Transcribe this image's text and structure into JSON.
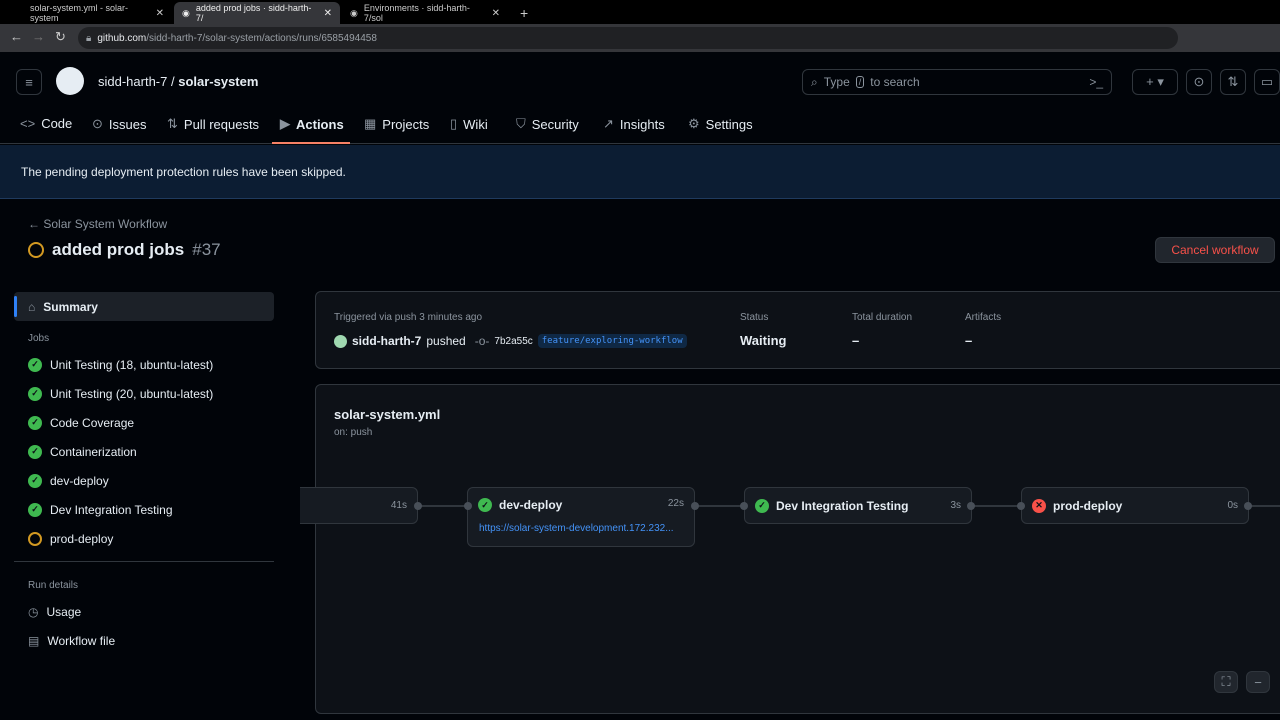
{
  "browser": {
    "tabs": [
      {
        "title": "solar-system.yml - solar-system"
      },
      {
        "title": "added prod jobs · sidd-harth-7/"
      },
      {
        "title": "Environments · sidd-harth-7/sol"
      }
    ],
    "url_domain": "github.com",
    "url_path": "/sidd-harth-7/solar-system/actions/runs/6585494458"
  },
  "header": {
    "owner": "sidd-harth-7",
    "repo": "solar-system",
    "search_pre": "Type",
    "search_key": "/",
    "search_post": "to search"
  },
  "repo_tabs": [
    "Code",
    "Issues",
    "Pull requests",
    "Actions",
    "Projects",
    "Wiki",
    "Security",
    "Insights",
    "Settings"
  ],
  "banner": "The pending deployment protection rules have been skipped.",
  "run": {
    "back": "Solar System Workflow",
    "title": "added prod jobs",
    "number": "#37",
    "cancel": "Cancel workflow"
  },
  "sidebar": {
    "summary": "Summary",
    "jobs_heading": "Jobs",
    "jobs": [
      {
        "name": "Unit Testing (18, ubuntu-latest)",
        "status": "success"
      },
      {
        "name": "Unit Testing (20, ubuntu-latest)",
        "status": "success"
      },
      {
        "name": "Code Coverage",
        "status": "success"
      },
      {
        "name": "Containerization",
        "status": "success"
      },
      {
        "name": "dev-deploy",
        "status": "success"
      },
      {
        "name": "Dev Integration Testing",
        "status": "success"
      },
      {
        "name": "prod-deploy",
        "status": "waiting"
      }
    ],
    "details_heading": "Run details",
    "usage": "Usage",
    "workflow_file": "Workflow file"
  },
  "summary": {
    "triggered": "Triggered via push 3 minutes ago",
    "actor": "sidd-harth-7",
    "action": "pushed",
    "commit": "7b2a55c",
    "branch": "feature/exploring-workflow",
    "status_label": "Status",
    "status": "Waiting",
    "duration_label": "Total duration",
    "duration": "–",
    "artifacts_label": "Artifacts",
    "artifacts": "–"
  },
  "graph": {
    "file": "solar-system.yml",
    "trigger": "on: push",
    "prev_duration": "41s",
    "jobs": [
      {
        "name": "dev-deploy",
        "duration": "22s",
        "link": "https://solar-system-development.172.232..."
      },
      {
        "name": "Dev Integration Testing",
        "duration": "3s"
      },
      {
        "name": "prod-deploy",
        "duration": "0s"
      }
    ]
  }
}
